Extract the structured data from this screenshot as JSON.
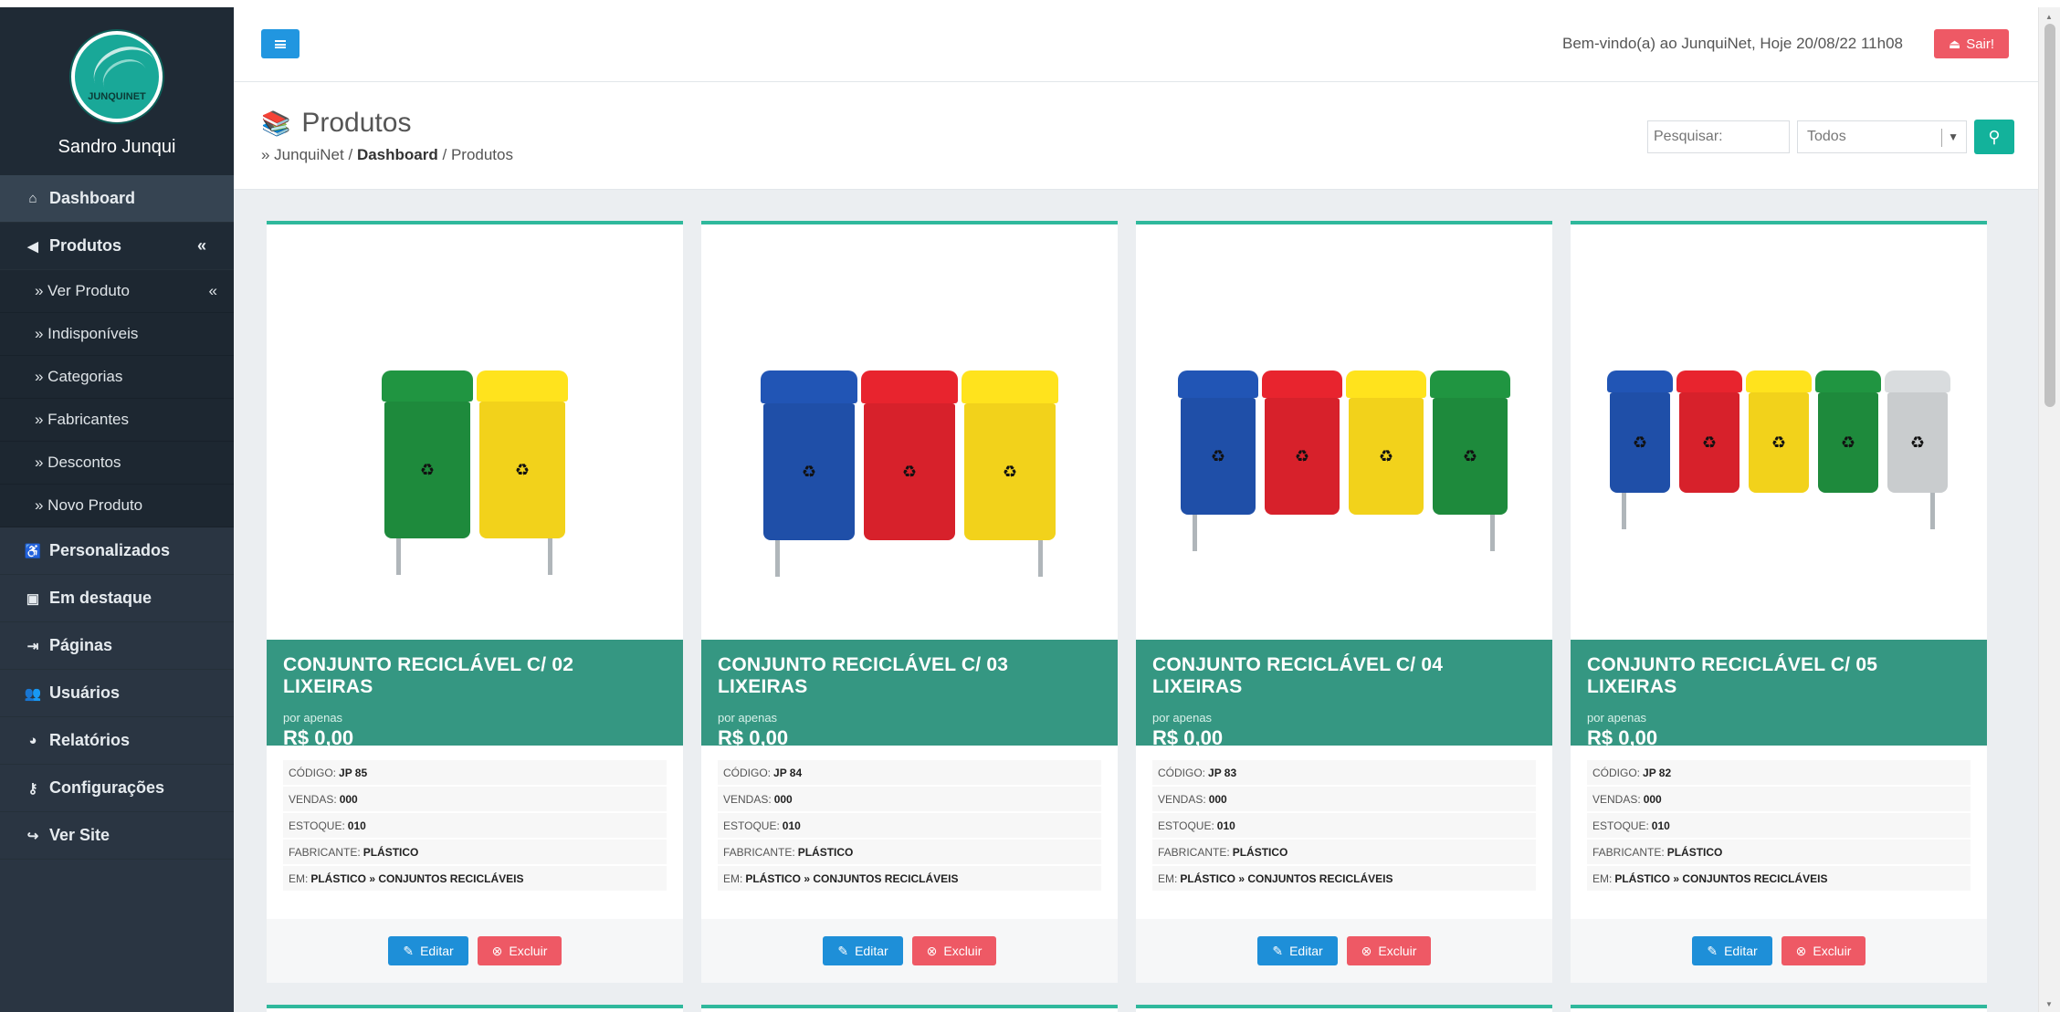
{
  "profile": {
    "name": "Sandro Junqui",
    "logo_text": "JUNQUINET"
  },
  "sidebar": {
    "items": [
      {
        "label": "Dashboard",
        "icon": "home-icon"
      },
      {
        "label": "Produtos",
        "icon": "megaphone-icon",
        "toggle": "«"
      },
      {
        "label": "Personalizados",
        "icon": "accessibility-icon"
      },
      {
        "label": "Em destaque",
        "icon": "image-icon"
      },
      {
        "label": "Páginas",
        "icon": "sign-in-icon"
      },
      {
        "label": "Usuários",
        "icon": "users-icon"
      },
      {
        "label": "Relatórios",
        "icon": "pie-chart-icon"
      },
      {
        "label": "Configurações",
        "icon": "key-icon"
      },
      {
        "label": "Ver Site",
        "icon": "share-icon"
      }
    ],
    "submenu": [
      {
        "label": "» Ver Produto",
        "toggle": "«"
      },
      {
        "label": "» Indisponíveis"
      },
      {
        "label": "» Categorias"
      },
      {
        "label": "» Fabricantes"
      },
      {
        "label": "» Descontos"
      },
      {
        "label": "» Novo Produto"
      }
    ]
  },
  "topbar": {
    "welcome": "Bem-vindo(a) ao JunquiNet, Hoje 20/08/22 11h08",
    "logout_label": "Sair!"
  },
  "header": {
    "title": "Produtos",
    "breadcrumb": {
      "root": "» JunquiNet",
      "sep": "/",
      "parent": "Dashboard",
      "current": "Produtos"
    },
    "search_placeholder": "Pesquisar:",
    "filter_selected": "Todos"
  },
  "labels": {
    "price_prefix": "por apenas",
    "code": "CÓDIGO:",
    "sales": "VENDAS:",
    "stock": "ESTOQUE:",
    "maker": "FABRICANTE:",
    "in": "EM:",
    "edit": "Editar",
    "delete": "Excluir"
  },
  "products": [
    {
      "title": "CONJUNTO RECICLÁVEL C/ 02 LIXEIRAS",
      "price": "R$ 0,00",
      "code": "JP 85",
      "sales": "000",
      "stock": "010",
      "maker": "PLÁSTICO",
      "category": "PLÁSTICO » CONJUNTOS RECICLÁVEIS",
      "bins": [
        "#1e8a3c",
        "#f2d21b"
      ]
    },
    {
      "title": "CONJUNTO RECICLÁVEL C/ 03 LIXEIRAS",
      "price": "R$ 0,00",
      "code": "JP 84",
      "sales": "000",
      "stock": "010",
      "maker": "PLÁSTICO",
      "category": "PLÁSTICO » CONJUNTOS RECICLÁVEIS",
      "bins": [
        "#1f4fa8",
        "#d7212b",
        "#f2d21b"
      ]
    },
    {
      "title": "CONJUNTO RECICLÁVEL C/ 04 LIXEIRAS",
      "price": "R$ 0,00",
      "code": "JP 83",
      "sales": "000",
      "stock": "010",
      "maker": "PLÁSTICO",
      "category": "PLÁSTICO » CONJUNTOS RECICLÁVEIS",
      "bins": [
        "#1f4fa8",
        "#d7212b",
        "#f2d21b",
        "#1e8a3c"
      ]
    },
    {
      "title": "CONJUNTO RECICLÁVEL C/ 05 LIXEIRAS",
      "price": "R$ 0,00",
      "code": "JP 82",
      "sales": "000",
      "stock": "010",
      "maker": "PLÁSTICO",
      "category": "PLÁSTICO » CONJUNTOS RECICLÁVEIS",
      "bins": [
        "#1f4fa8",
        "#d7212b",
        "#f2d21b",
        "#1e8a3c",
        "#c9ccce"
      ]
    }
  ],
  "colors": {
    "sidebar": "#2a3542",
    "accent": "#2fb89c",
    "band": "#359782",
    "edit": "#1e8fd8",
    "delete": "#ee5965",
    "search": "#13b29b"
  }
}
